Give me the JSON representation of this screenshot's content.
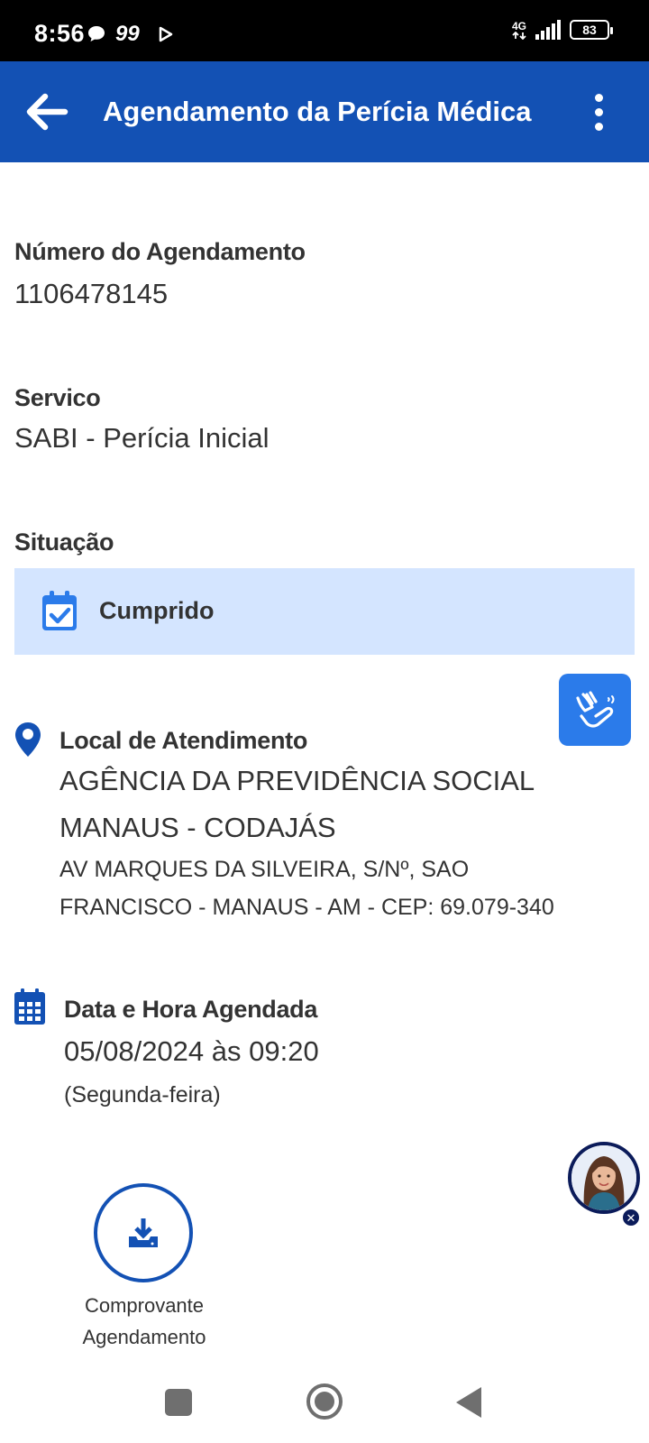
{
  "status_bar": {
    "time": "8:56",
    "app_badge": "99",
    "network": "4G",
    "battery": "83"
  },
  "app_bar": {
    "title": "Agendamento da Perícia Médica"
  },
  "appointment_number": {
    "label": "Número do Agendamento",
    "value": "1106478145"
  },
  "service": {
    "label": "Servico",
    "value": "SABI - Perícia Inicial"
  },
  "situation": {
    "label": "Situação",
    "status": "Cumprido"
  },
  "location": {
    "label": "Local de Atendimento",
    "name_line1": "AGÊNCIA DA PREVIDÊNCIA SOCIAL",
    "name_line2": "MANAUS - CODAJÁS",
    "address_line1": "AV MARQUES DA SILVEIRA, S/Nº, SAO",
    "address_line2": "FRANCISCO - MANAUS - AM - CEP: 69.079-340"
  },
  "schedule": {
    "label": "Data e Hora Agendada",
    "datetime": "05/08/2024 às 09:20",
    "weekday": "(Segunda-feira)"
  },
  "download": {
    "label_line1": "Comprovante",
    "label_line2": "Agendamento"
  },
  "colors": {
    "primary": "#1351b4",
    "status_background": "#d4e5ff",
    "libras_button": "#2b7bea",
    "text": "#333333"
  },
  "icons": {
    "back": "arrow-left-icon",
    "menu": "more-vert-icon",
    "status": "calendar-check-icon",
    "libras": "sign-language-hands-icon",
    "location": "map-pin-icon",
    "schedule": "calendar-icon",
    "download": "download-icon"
  }
}
